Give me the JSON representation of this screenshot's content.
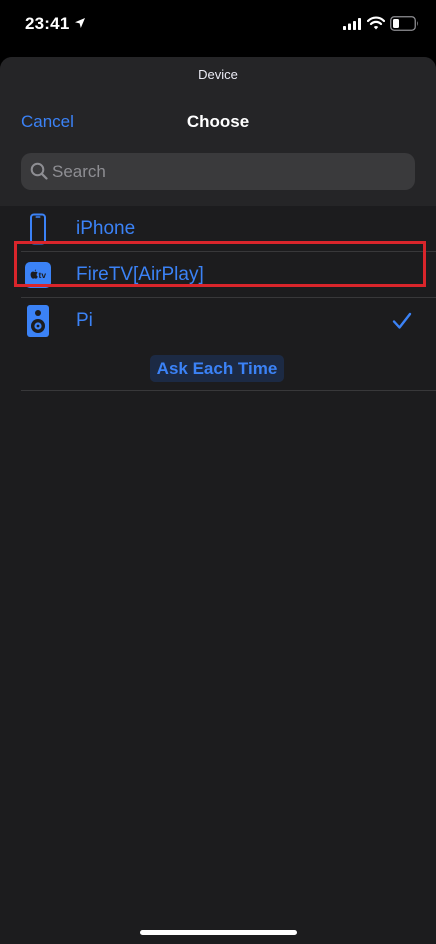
{
  "status_bar": {
    "time": "23:41",
    "icons": [
      "location-arrow-icon",
      "cellular-signal-icon",
      "wifi-icon",
      "battery-icon"
    ]
  },
  "sheet": {
    "subtitle": "Device",
    "title": "Choose",
    "cancel_label": "Cancel",
    "search": {
      "placeholder": "Search",
      "value": ""
    }
  },
  "devices": [
    {
      "label": "iPhone",
      "icon": "iphone-icon",
      "selected": false
    },
    {
      "label": "FireTV[AirPlay]",
      "icon": "apple-tv-icon",
      "icon_text": "tv",
      "selected": false
    },
    {
      "label": "Pi",
      "icon": "speaker-icon",
      "selected": true
    }
  ],
  "ask_each_time_label": "Ask Each Time",
  "colors": {
    "accent": "#3b82f6",
    "sheet_background": "#1c1c1e",
    "header_background": "#252527",
    "highlight": "#d9252b"
  }
}
